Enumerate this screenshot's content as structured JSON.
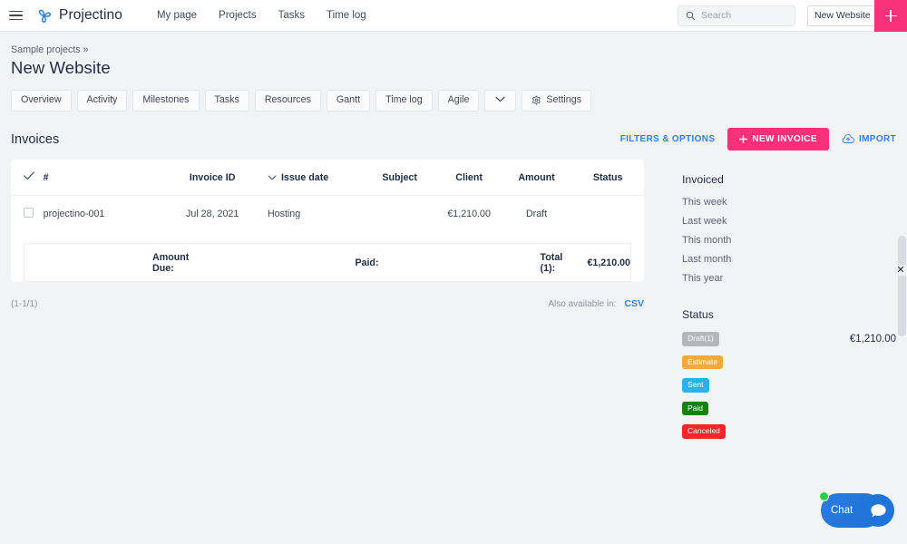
{
  "topbar": {
    "menu_icon": "hamburger-menu-icon",
    "logo_icon": "projectino-logo-icon",
    "brand": "Projectino",
    "nav": [
      {
        "label": "My page"
      },
      {
        "label": "Projects"
      },
      {
        "label": "Tasks"
      },
      {
        "label": "Time log"
      }
    ],
    "search": {
      "icon": "search-icon",
      "placeholder": "Search",
      "value": ""
    },
    "project_select": {
      "value": "New Website",
      "icon": "select-updown-icon"
    },
    "add_button": {
      "icon": "plus-icon",
      "label": ""
    }
  },
  "breadcrumb": "Sample projects »",
  "page_title": "New Website",
  "tabs": [
    {
      "label": "Overview"
    },
    {
      "label": "Activity"
    },
    {
      "label": "Milestones"
    },
    {
      "label": "Tasks"
    },
    {
      "label": "Resources"
    },
    {
      "label": "Gantt"
    },
    {
      "label": "Time log"
    },
    {
      "label": "Agile"
    },
    {
      "label": "",
      "icon": "chevron-down-icon"
    },
    {
      "label": "Settings",
      "icon": "gear-icon"
    }
  ],
  "section": {
    "title": "Invoices",
    "filters_label": "FILTERS & OPTIONS",
    "new_invoice_label": "NEW INVOICE",
    "import_label": "IMPORT"
  },
  "table": {
    "headers": {
      "check": "check-icon",
      "num": "#",
      "invoice_id": "Invoice ID",
      "issue_date": "Issue date",
      "subject": "Subject",
      "client": "Client",
      "amount": "Amount",
      "status": "Status"
    },
    "rows": [
      {
        "num": "projectino-001",
        "invoice_id": "Jul 28, 2021",
        "issue_date": "Hosting",
        "subject": "",
        "client": "",
        "amount": "€1,210.00",
        "status": "Draft"
      }
    ],
    "totals": {
      "amount_due_label": "Amount Due:",
      "amount_due_value": "",
      "paid_label": "Paid:",
      "paid_value": "",
      "total_label": "Total (1):",
      "total_value": "€1,210.00"
    },
    "pagination": "(1-1/1)",
    "also_available_label": "Also available in:",
    "export_format": "CSV"
  },
  "sidebar": {
    "invoiced_title": "Invoiced",
    "invoiced_links": [
      {
        "label": "This week"
      },
      {
        "label": "Last week"
      },
      {
        "label": "This month"
      },
      {
        "label": "Last month"
      },
      {
        "label": "This year"
      }
    ],
    "status_title": "Status",
    "statuses": [
      {
        "label": "Draft(1)",
        "color": "#b3b6bb",
        "value": "€1,210.00"
      },
      {
        "label": "Estimate",
        "color": "#f4a93c",
        "value": ""
      },
      {
        "label": "Sent",
        "color": "#2bb2ee",
        "value": ""
      },
      {
        "label": "Paid",
        "color": "#17800f",
        "value": ""
      },
      {
        "label": "Canceled",
        "color": "#f4262c",
        "value": ""
      }
    ]
  },
  "chat": {
    "label": "Chat",
    "icon": "chat-bubble-icon",
    "status_icon": "online-dot-icon"
  },
  "close_icon": "close-icon",
  "colors": {
    "accent_pink": "#f9317a",
    "link_blue": "#2f80ed",
    "brand_blue": "#2e7fe0"
  }
}
